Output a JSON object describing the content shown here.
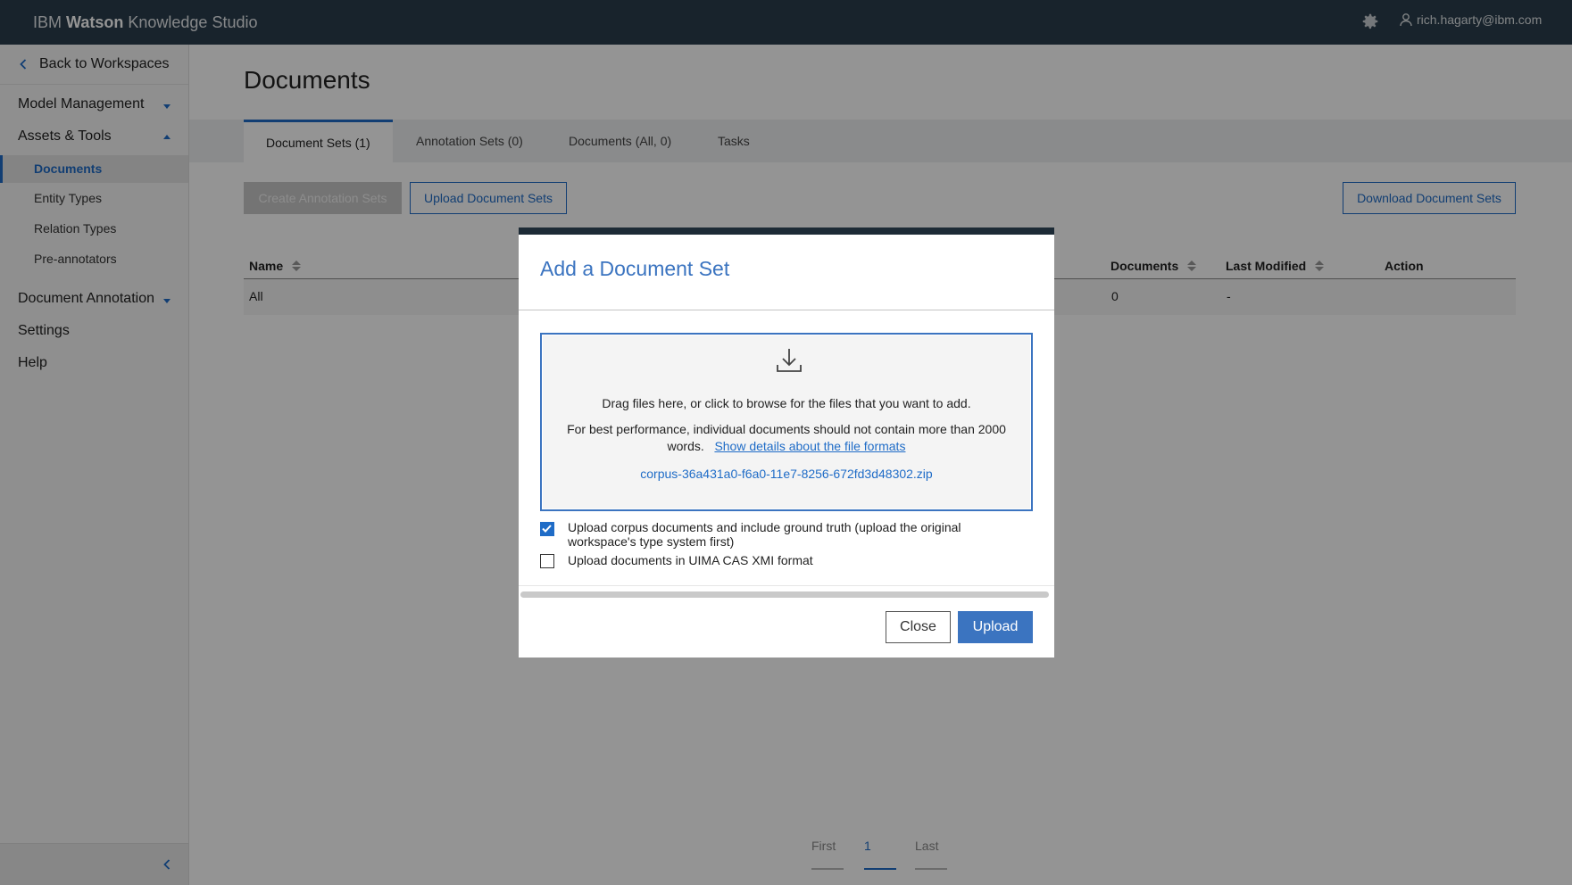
{
  "app": {
    "brand_prefix": "IBM",
    "brand_bold": "Watson",
    "brand_suffix": "Knowledge Studio",
    "user": "rich.hagarty@ibm.com"
  },
  "sidebar": {
    "back": "Back to Workspaces",
    "sections": [
      {
        "label": "Model Management"
      },
      {
        "label": "Assets & Tools"
      },
      {
        "label": "Document Annotation"
      },
      {
        "label": "Settings"
      },
      {
        "label": "Help"
      }
    ],
    "items": [
      {
        "label": "Documents"
      },
      {
        "label": "Entity Types"
      },
      {
        "label": "Relation Types"
      },
      {
        "label": "Pre-annotators"
      }
    ]
  },
  "page": {
    "title": "Documents",
    "tabs": [
      {
        "label": "Document Sets (1)"
      },
      {
        "label": "Annotation Sets (0)"
      },
      {
        "label": "Documents (All, 0)"
      },
      {
        "label": "Tasks"
      }
    ],
    "toolbar": {
      "create": "Create Annotation Sets",
      "upload": "Upload Document Sets",
      "download": "Download Document Sets"
    },
    "table": {
      "columns": [
        "Name",
        "Documents",
        "Last Modified",
        "Action"
      ],
      "rows": [
        {
          "name": "All",
          "documents": "0",
          "last_modified": "-",
          "action": ""
        }
      ]
    },
    "pager": {
      "first": "First",
      "current": "1",
      "last": "Last"
    }
  },
  "modal": {
    "title": "Add a Document Set",
    "drop_text": "Drag files here, or click to browse for the files that you want to add.",
    "perf_text_1": "For best performance, individual documents should not contain more than 2000",
    "perf_text_2": "words.",
    "details_link": "Show details about the file formats",
    "file_name": "corpus-36a431a0-f6a0-11e7-8256-672fd3d48302.zip",
    "checkbox1": {
      "label": "Upload corpus documents and include ground truth (upload the original workspace's type system first)",
      "checked": true
    },
    "checkbox2": {
      "label": "Upload documents in UIMA CAS XMI format",
      "checked": false
    },
    "close": "Close",
    "upload": "Upload"
  },
  "colors": {
    "accent": "#1f6cc7",
    "header": "#2a3d4c",
    "modal_title": "#3b74c0"
  }
}
